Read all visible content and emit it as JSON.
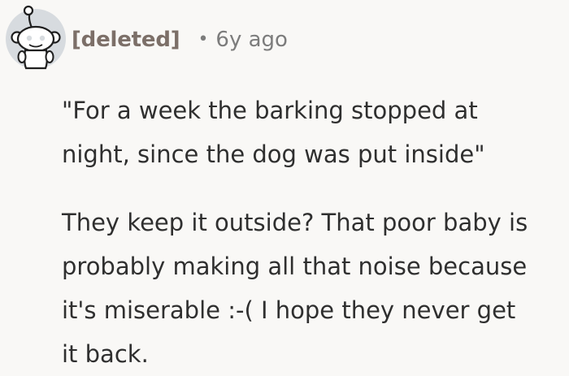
{
  "comment": {
    "author": "[deleted]",
    "separator": "•",
    "timestamp": "6y ago",
    "avatar_icon": "snoo-avatar-icon",
    "paragraphs": [
      "\"For a week the barking stopped at\nnight, since the dog was put inside\"",
      "They keep it outside? That poor baby is\nprobably making all that noise because\nit's miserable :-( I hope they never get\nit back."
    ]
  }
}
